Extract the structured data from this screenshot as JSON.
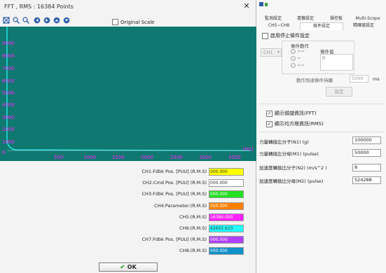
{
  "dialog": {
    "title": "FFT , RMS : 16384 Points",
    "close": "✕",
    "original_scale": "Original Scale",
    "ok_label": "OK"
  },
  "toolbar_icons": [
    "zoom-fit-icon",
    "zoom-in-icon",
    "zoom-out-icon",
    "pan-left-icon",
    "pan-right-icon",
    "pan-up-icon",
    "pan-down-icon"
  ],
  "plot": {
    "background": "#0f7870",
    "tick_color": "#ff22ff",
    "y_ticks": [
      "9000",
      "8000",
      "7000",
      "6000",
      "5000",
      "4000",
      "3000",
      "2000",
      "1000",
      "0"
    ],
    "x_ticks": [
      "500",
      "1000",
      "1500",
      "2000",
      "2500",
      "3000",
      "3500"
    ],
    "x_unit": "[Hz]"
  },
  "channels": [
    {
      "label": "CH1:Fdbk  Pos. [PUU] (R.M.S)",
      "value": "000.000",
      "color": "#ffff00"
    },
    {
      "label": "CH2:Cmd  Pos. [PUU] (R.M.S)",
      "value": "000.000",
      "color": "#ffffff"
    },
    {
      "label": "CH3:Fdbk  Pos. [PUU] (R.M.S)",
      "value": "000.000",
      "color": "#22e022"
    },
    {
      "label": "CH4:Parameter:(R.M.S)",
      "value": "000.000",
      "color": "#ff8000"
    },
    {
      "label": "CH5:(R.M.S)",
      "value": "16384.000",
      "color": "#ff22ff"
    },
    {
      "label": "CH6:(R.M.S)",
      "value": "42655.623",
      "color": "#22ffff"
    },
    {
      "label": "CH7:Fdbk  Pos. [PUU] (R.M.S)",
      "value": "000.000",
      "color": "#b040ff"
    },
    {
      "label": "CH8:(R.M.S)",
      "value": "000.000",
      "color": "#1090c8"
    }
  ],
  "right_panel": {
    "tabs_row1": [
      "監測設定",
      "書籤設定",
      "操控板",
      "Multi-Scope"
    ],
    "tabs_row2": [
      "CH5~CH8",
      "條件設定",
      "精確度設定"
    ],
    "enable_stop_condition": "啟用停止條件設定",
    "condition_action": "條件動作",
    "channel_select": "CH1",
    "condition_value": "條件值",
    "condition_value_input": "0",
    "radio_options": [
      ">=",
      "=",
      "<="
    ],
    "condition_duration": "動作到達條件持續",
    "duration_value": "5000",
    "duration_unit": "ms",
    "settings_button": "設定",
    "show_fft": "顯示頻譜資訊(FFT)",
    "show_rms": "顯示均方根資訊(RMS)",
    "params": [
      {
        "label": "力量轉換比分子(N1) (g)",
        "value": "100000"
      },
      {
        "label": "力量轉換比分母(M1) (pulse)",
        "value": "50000"
      },
      {
        "label": "加速度轉換比分子(N2)  (m/s^2 )",
        "value": "8"
      },
      {
        "label": "加速度轉換比分母(M2)  (pulse)",
        "value": "524288"
      }
    ]
  }
}
